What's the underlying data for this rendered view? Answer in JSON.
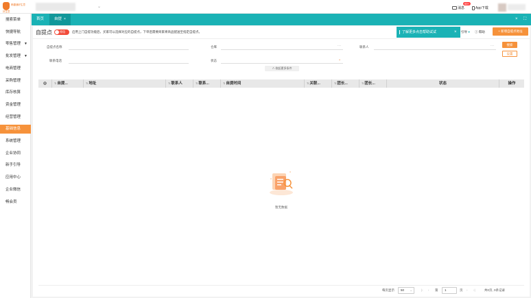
{
  "header": {
    "logo_text": "畅捷通好生意",
    "logo_sub": "好生意",
    "messages_label": "消息",
    "messages_badge": "99+",
    "app_download_label": "App下载"
  },
  "sidebar": {
    "items": [
      {
        "label": "搜索菜单",
        "has_caret": false
      },
      {
        "label": "快捷导航",
        "has_caret": false
      },
      {
        "label": "零售管理",
        "has_caret": true
      },
      {
        "label": "批发管理",
        "has_caret": true
      },
      {
        "label": "电商管理",
        "has_caret": false
      },
      {
        "label": "采购管理",
        "has_caret": false
      },
      {
        "label": "库存核算",
        "has_caret": false
      },
      {
        "label": "资金管理",
        "has_caret": false
      },
      {
        "label": "经营管理",
        "has_caret": false
      },
      {
        "label": "基础信息",
        "has_caret": false,
        "active": true
      },
      {
        "label": "系统管理",
        "has_caret": false
      },
      {
        "label": "企业协同",
        "has_caret": false
      },
      {
        "label": "新手引导",
        "has_caret": false
      },
      {
        "label": "应用中心",
        "has_caret": false
      },
      {
        "label": "企业微信",
        "has_caret": false
      },
      {
        "label": "畅会员",
        "has_caret": false
      }
    ]
  },
  "tabs": [
    {
      "label": "首页",
      "active": false
    },
    {
      "label": "自提",
      "active": true,
      "closable": "×"
    }
  ],
  "tabbar_controls": {
    "close": "×",
    "fullscreen": "⛶"
  },
  "page": {
    "title": "自提点",
    "toggle_label": "停用",
    "tip": "启用上门自提功能后，买家可以选择对应的自提点，下单后需要商家将商品配送至指定自提点。",
    "guide_banner": "了解更多点击帮助试试",
    "guide_close": "×",
    "guide_label": "引导",
    "help_label": "帮助",
    "new_button": "+ 新增自提点地址"
  },
  "filters": {
    "name_label": "自提点名称",
    "warehouse_label": "仓库",
    "contact_label": "联系人",
    "phone_label": "联系电话",
    "status_label": "状态",
    "search_button": "搜索",
    "reset_button": "设置",
    "expand_label": "∧ 收起更多条件",
    "dots": "···"
  },
  "table": {
    "columns": [
      "自提...",
      "地址",
      "联系人",
      "联系...",
      "自提时间",
      "关联...",
      "团长...",
      "团长...",
      "状态",
      "操作"
    ],
    "settings_icon": "◎",
    "sort_arrow": "⇅",
    "empty_text": "暂无数据"
  },
  "pagination": {
    "per_page_label": "每页显示",
    "per_page_value": "50",
    "page_prefix": "第",
    "page_value": "1",
    "page_suffix": "页",
    "total_text": "共0页, 0条记录"
  },
  "colors": {
    "accent": "#f6923b",
    "teal": "#1ab2b5",
    "danger": "#f24b3a"
  }
}
